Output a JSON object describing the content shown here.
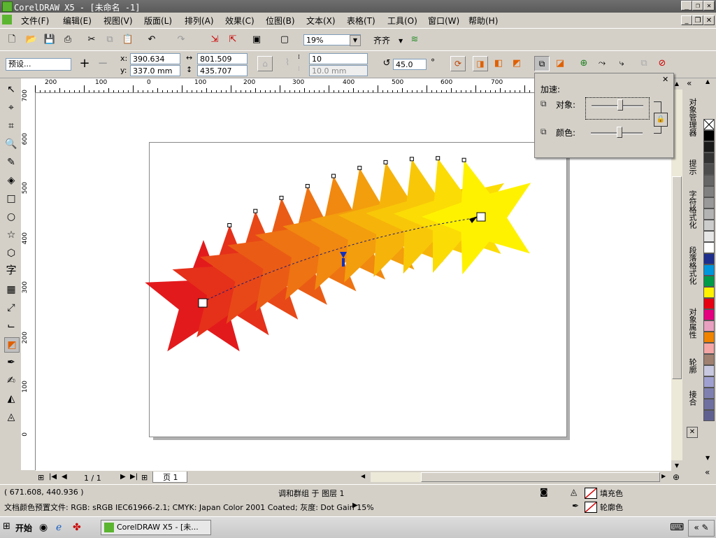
{
  "window": {
    "title": "CorelDRAW X5 - [未命名 -1]",
    "btn_min": "_",
    "btn_restore": "❐",
    "btn_close": "✕"
  },
  "menu": [
    "文件(F)",
    "编辑(E)",
    "视图(V)",
    "版面(L)",
    "排列(A)",
    "效果(C)",
    "位图(B)",
    "文本(X)",
    "表格(T)",
    "工具(O)",
    "窗口(W)",
    "帮助(H)"
  ],
  "toolbar": {
    "zoom": "19%",
    "align_label": "齐齐"
  },
  "propbar": {
    "preset": "预设...",
    "x_label": "x:",
    "x": "390.634 mm",
    "y_label": "y:",
    "y": "337.0 mm",
    "w": "801.509 mm",
    "h": "435.707 mm",
    "steps": "10",
    "spacing": "10.0 mm",
    "rotation": "45.0",
    "degree": "°"
  },
  "accel_popup": {
    "title": "加速:",
    "objects": "对象:",
    "colors": "颜色:",
    "objects_value": 0.55,
    "colors_value": 0.55
  },
  "hruler": [
    "200",
    "100",
    "0",
    "100",
    "200",
    "300",
    "400",
    "500",
    "600",
    "700"
  ],
  "vruler": [
    "700",
    "600",
    "500",
    "400",
    "300",
    "200",
    "100",
    "0"
  ],
  "dockers": [
    "对象管理器",
    "提示",
    "字符格式化",
    "段落格式化",
    "对象属性",
    "轮廓",
    "接合"
  ],
  "palette": [
    "#ffffff",
    "#000000",
    "#1a1a1a",
    "#333333",
    "#4d4d4d",
    "#666666",
    "#808080",
    "#999999",
    "#b3b3b3",
    "#cccccc",
    "#e6e6e6",
    "#ffffff",
    "#1e2e8c",
    "#0096dc",
    "#009b48",
    "#fff200",
    "#e60012",
    "#e4007f",
    "#e8a0c0",
    "#f08300",
    "#f4a6a6",
    "#a08070",
    "#c8c8e0",
    "#a0a0d0",
    "#8080b0",
    "#7070a0",
    "#606090"
  ],
  "pagenav": {
    "page_count": "1 / 1",
    "page_tab": "页 1"
  },
  "status": {
    "coords": "( 671.608, 440.936 )",
    "selection": "调和群组 于 图层 1",
    "fill_label": "填充色",
    "outline_label": "轮廓色",
    "color_profile": "文档颜色预置文件: RGB: sRGB IEC61966-2.1; CMYK: Japan Color 2001 Coated; 灰度: Dot Gain 15%"
  },
  "taskbar": {
    "start": "开始",
    "task": "CorelDRAW X5 - [未..."
  }
}
